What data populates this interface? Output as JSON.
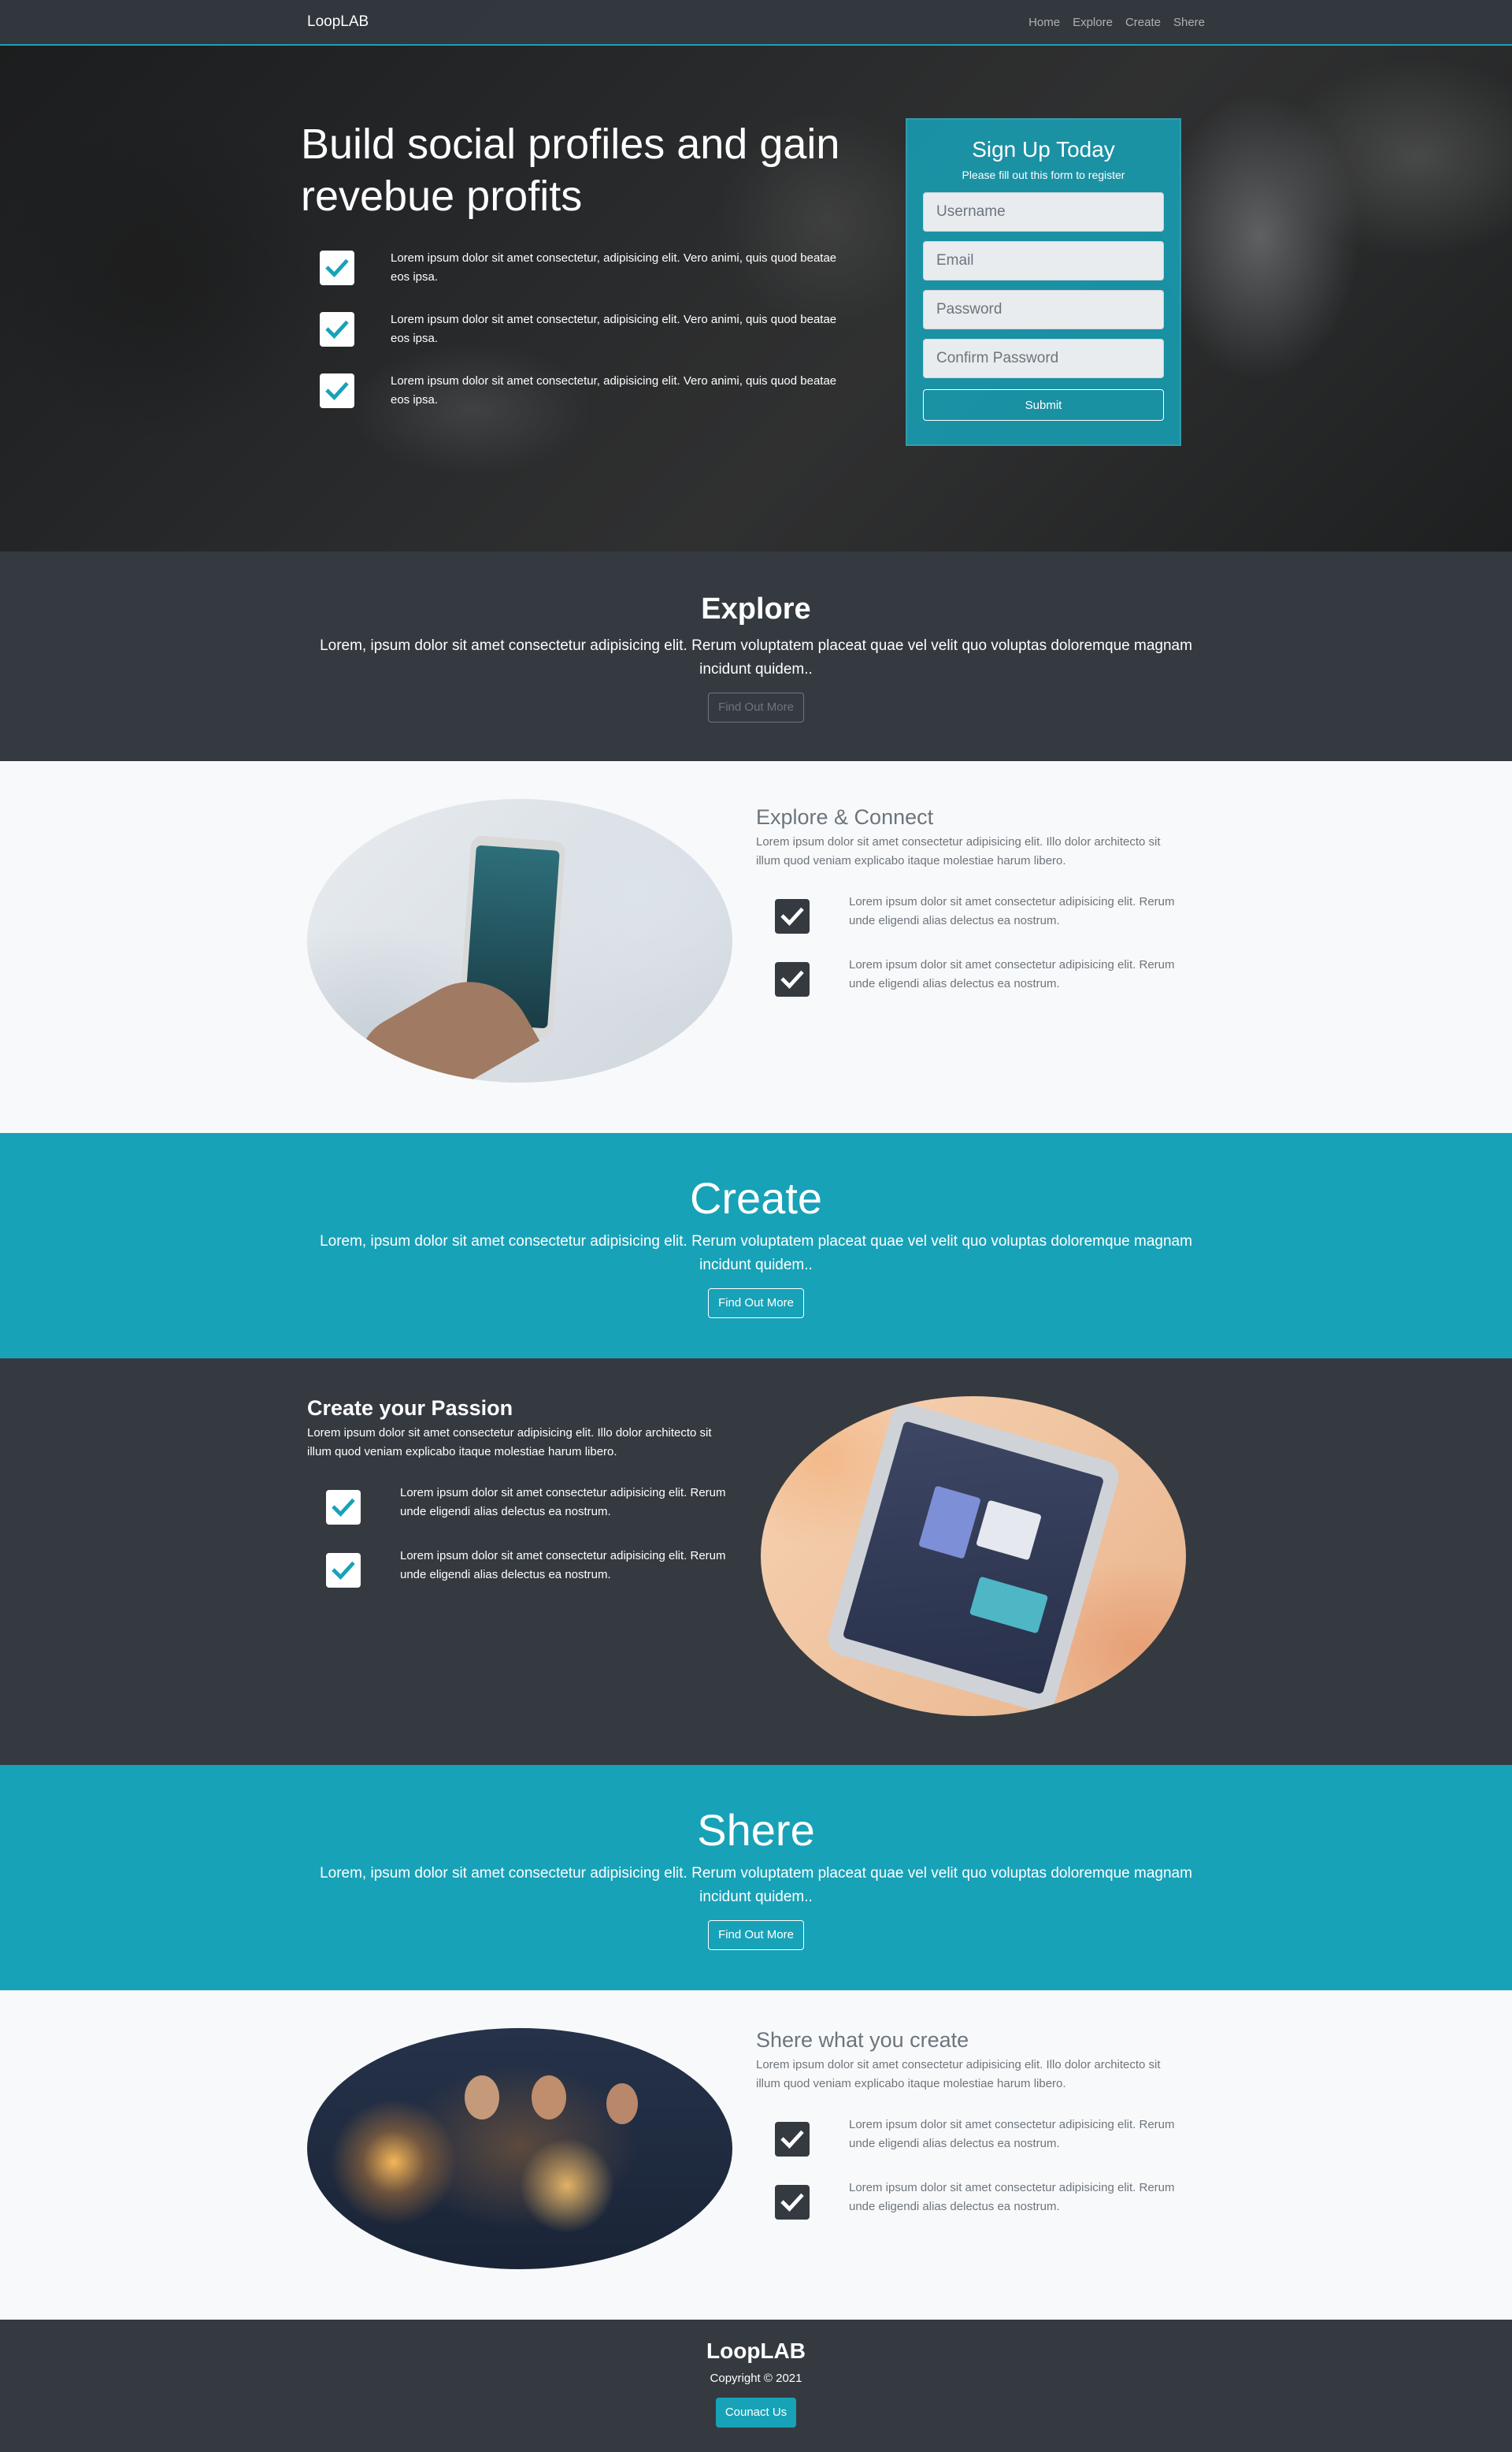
{
  "nav": {
    "brand": "LoopLAB",
    "links": [
      "Home",
      "Explore",
      "Create",
      "Shere"
    ]
  },
  "hero": {
    "title_part1": "Build ",
    "title_bold1": "social profiles",
    "title_part2": " and gain",
    "title_part3": "revebue ",
    "title_bold2": "profits",
    "features": [
      "Lorem ipsum dolor sit amet consectetur, adipisicing elit. Vero animi, quis quod beatae eos ipsa.",
      "Lorem ipsum dolor sit amet consectetur, adipisicing elit. Vero animi, quis quod beatae eos ipsa.",
      "Lorem ipsum dolor sit amet consectetur, adipisicing elit. Vero animi, quis quod beatae eos ipsa."
    ]
  },
  "signup": {
    "title": "Sign Up Today",
    "subtitle": "Please fill out this form to register",
    "username_placeholder": "Username",
    "email_placeholder": "Email",
    "password_placeholder": "Password",
    "confirm_placeholder": "Confirm Password",
    "submit_label": "Submit"
  },
  "explore_band": {
    "title": "Explore",
    "text": "Lorem, ipsum dolor sit amet consectetur adipisicing elit. Rerum voluptatem placeat quae vel velit quo voluptas doloremque magnam incidunt quidem..",
    "button": "Find Out More"
  },
  "explore_section": {
    "title": "Explore & Connect",
    "lead": "Lorem ipsum dolor sit amet consectetur adipisicing elit. Illo dolor architecto sit illum quod veniam explicabo itaque molestiae harum libero.",
    "items": [
      "Lorem ipsum dolor sit amet consectetur adipisicing elit. Rerum unde eligendi alias delectus ea nostrum.",
      "Lorem ipsum dolor sit amet consectetur adipisicing elit. Rerum unde eligendi alias delectus ea nostrum."
    ]
  },
  "create_band": {
    "title": "Create",
    "text": "Lorem, ipsum dolor sit amet consectetur adipisicing elit. Rerum voluptatem placeat quae vel velit quo voluptas doloremque magnam incidunt quidem..",
    "button": "Find Out More"
  },
  "create_section": {
    "title": "Create your Passion",
    "lead": "Lorem ipsum dolor sit amet consectetur adipisicing elit. Illo dolor architecto sit illum quod veniam explicabo itaque molestiae harum libero.",
    "items": [
      "Lorem ipsum dolor sit amet consectetur adipisicing elit. Rerum unde eligendi alias delectus ea nostrum.",
      "Lorem ipsum dolor sit amet consectetur adipisicing elit. Rerum unde eligendi alias delectus ea nostrum."
    ]
  },
  "share_band": {
    "title": "Shere",
    "text": "Lorem, ipsum dolor sit amet consectetur adipisicing elit. Rerum voluptatem placeat quae vel velit quo voluptas doloremque magnam incidunt quidem..",
    "button": "Find Out More"
  },
  "share_section": {
    "title": "Shere what you create",
    "lead": "Lorem ipsum dolor sit amet consectetur adipisicing elit. Illo dolor architecto sit illum quod veniam explicabo itaque molestiae harum libero.",
    "items": [
      "Lorem ipsum dolor sit amet consectetur adipisicing elit. Rerum unde eligendi alias delectus ea nostrum.",
      "Lorem ipsum dolor sit amet consectetur adipisicing elit. Rerum unde eligendi alias delectus ea nostrum."
    ]
  },
  "footer": {
    "brand": "LoopLAB",
    "copyright": "Copyright © 2021",
    "contact_button": "Counact Us"
  },
  "colors": {
    "primary": "#17a2b8",
    "dark": "#343a40",
    "light": "#f8f9fa"
  },
  "icons": {
    "check": "check-square-icon"
  }
}
